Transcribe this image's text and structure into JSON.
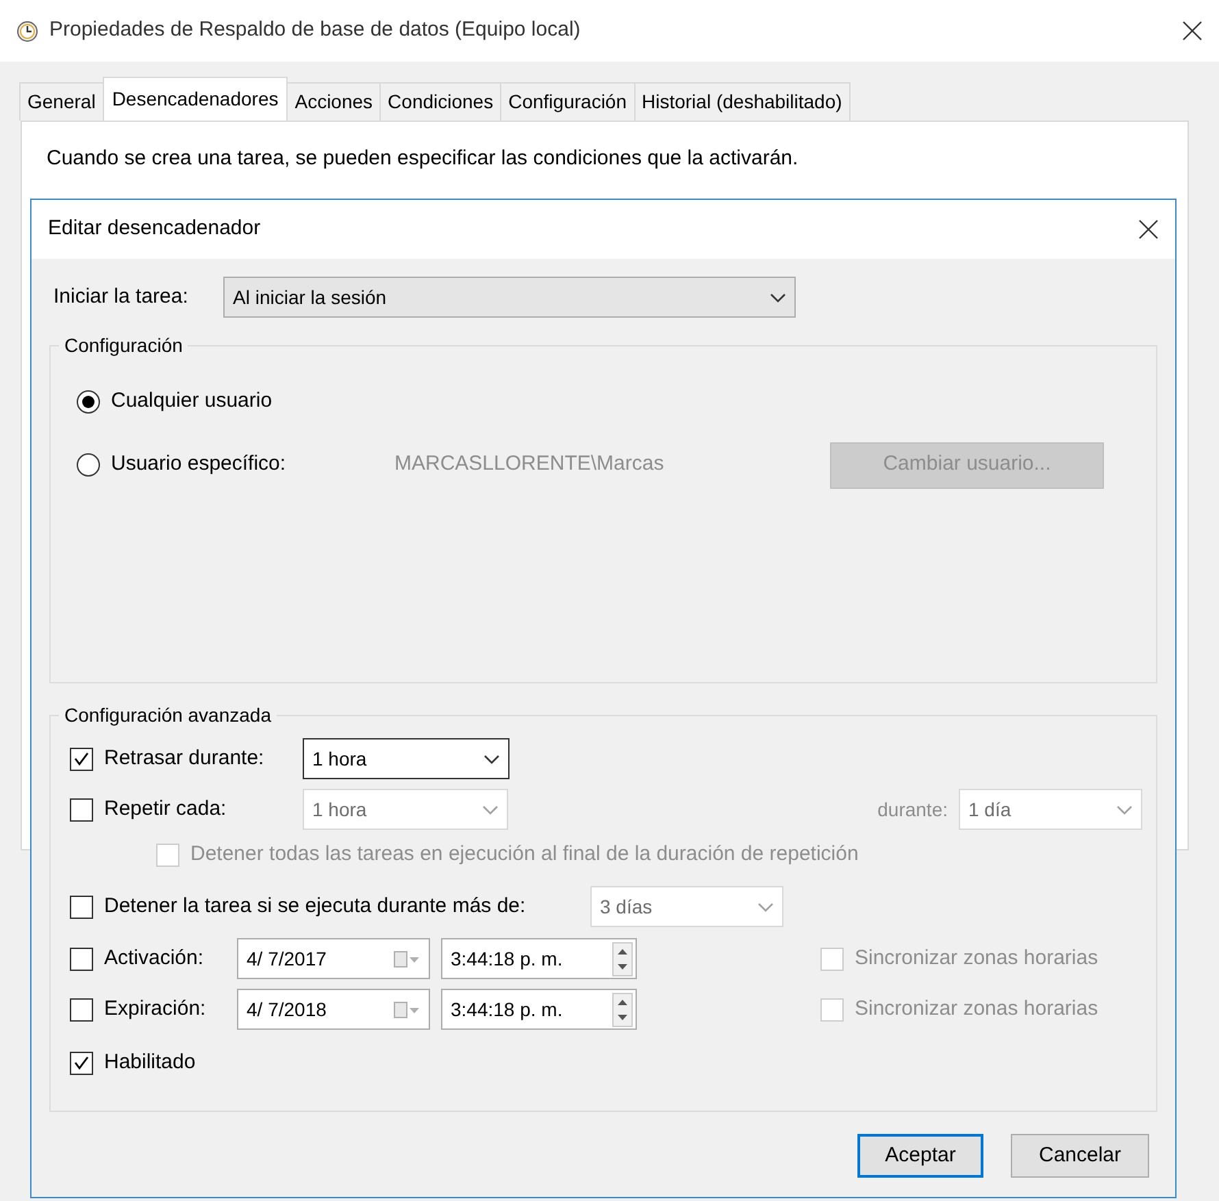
{
  "window": {
    "title": "Propiedades de Respaldo de base de datos (Equipo local)"
  },
  "tabs": [
    {
      "label": "General",
      "selected": false
    },
    {
      "label": "Desencadenadores",
      "selected": true
    },
    {
      "label": "Acciones",
      "selected": false
    },
    {
      "label": "Condiciones",
      "selected": false
    },
    {
      "label": "Configuración",
      "selected": false
    },
    {
      "label": "Historial (deshabilitado)",
      "selected": false
    }
  ],
  "description": "Cuando se crea una tarea, se pueden especificar las condiciones que la activarán.",
  "dialog": {
    "title": "Editar desencadenador",
    "start_task": {
      "label": "Iniciar la tarea:",
      "value": "Al iniciar la sesión"
    },
    "settings": {
      "legend": "Configuración",
      "options": [
        {
          "label": "Cualquier usuario",
          "selected": true
        },
        {
          "label": "Usuario específico:",
          "selected": false
        }
      ],
      "user": {
        "value": "MARCASLLORENTE\\Marcas",
        "disabled": true
      },
      "change_user_button": {
        "label": "Cambiar usuario...",
        "disabled": true
      }
    },
    "advanced": {
      "legend": "Configuración avanzada",
      "delay": {
        "label": "Retrasar durante:",
        "checked": true,
        "value": "1 hora",
        "disabled": false
      },
      "repeat": {
        "label": "Repetir cada:",
        "checked": false,
        "value": "1 hora",
        "disabled": true,
        "duration_label": "durante:",
        "duration_value": "1 día"
      },
      "stop_all": {
        "label": "Detener todas las tareas en ejecución al final de la duración de repetición",
        "checked": false,
        "disabled": true
      },
      "stop_task": {
        "label": "Detener la tarea si se ejecuta durante más de:",
        "checked": false,
        "value": "3 días",
        "disabled": true
      },
      "dates": [
        {
          "label": "Activación:",
          "checked": false,
          "date": "4/  7/2017",
          "time": "3:44:18 p. m.",
          "sync": {
            "label": "Sincronizar zonas horarias",
            "checked": false,
            "disabled": true
          }
        },
        {
          "label": "Expiración:",
          "checked": false,
          "date": "4/  7/2018",
          "time": "3:44:18 p. m.",
          "sync": {
            "label": "Sincronizar zonas horarias",
            "checked": false,
            "disabled": true
          }
        }
      ],
      "enabled": {
        "label": "Habilitado",
        "checked": true
      }
    },
    "buttons": [
      {
        "label": "Aceptar",
        "default": true
      },
      {
        "label": "Cancelar",
        "default": false
      }
    ]
  }
}
